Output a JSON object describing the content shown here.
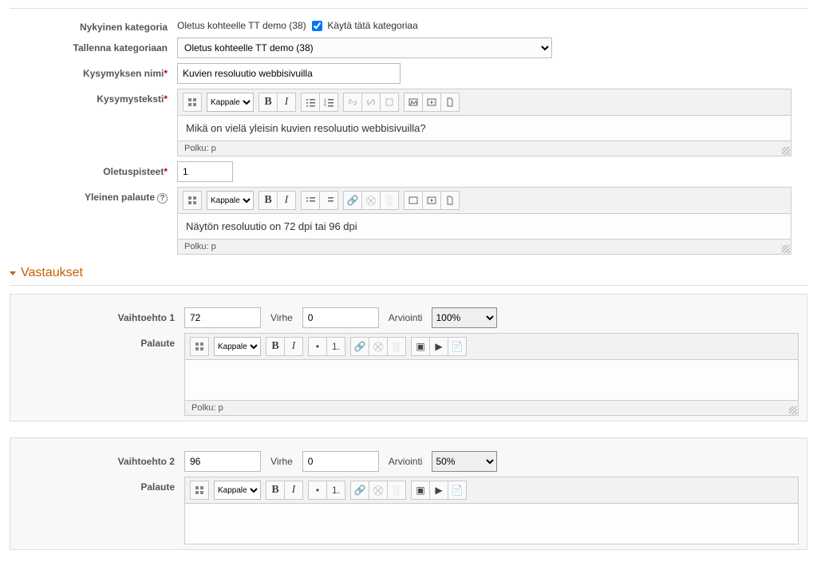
{
  "labels": {
    "current_category": "Nykyinen kategoria",
    "current_category_value": "Oletus kohteelle TT demo (38)",
    "use_this_category": "Käytä tätä kategoriaa",
    "save_in_category": "Tallenna kategoriaan",
    "question_name": "Kysymyksen nimi",
    "question_text": "Kysymysteksti",
    "default_points": "Oletuspisteet",
    "general_feedback": "Yleinen palaute",
    "answers": "Vastaukset",
    "choice1": "Vaihtoehto 1",
    "choice2": "Vaihtoehto 2",
    "error": "Virhe",
    "grade": "Arviointi",
    "feedback": "Palaute",
    "path": "Polku: p",
    "toolbar_format": "Kappale",
    "toolbar_b": "B",
    "toolbar_i": "I"
  },
  "values": {
    "save_category_option": "Oletus kohteelle TT demo (38)",
    "question_name": "Kuvien resoluutio webbisivuilla",
    "question_text": "Mikä on vielä yleisin kuvien resoluutio webbisivuilla?",
    "default_points": "1",
    "general_feedback": "Näytön resoluutio on 72 dpi tai 96 dpi"
  },
  "answers": [
    {
      "value": "72",
      "error": "0",
      "grade": "100%",
      "feedback": ""
    },
    {
      "value": "96",
      "error": "0",
      "grade": "50%",
      "feedback": ""
    }
  ],
  "use_this_category_checked": true
}
